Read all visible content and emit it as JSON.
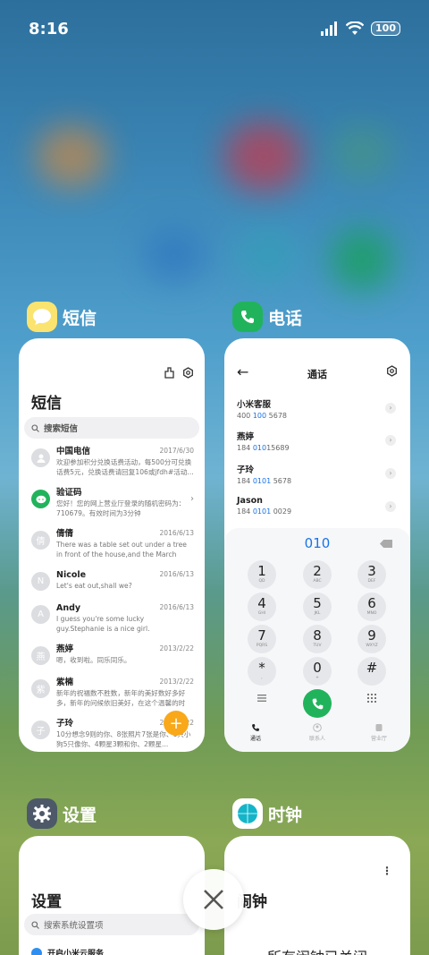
{
  "status": {
    "time": "8:16",
    "battery": "100"
  },
  "apps": {
    "messages": {
      "label": "短信",
      "title": "短信",
      "search_placeholder": "搜索短信",
      "items": [
        {
          "avatar": "",
          "name": "中国电信",
          "date": "2017/6/30",
          "body": "欢迎参加积分兑换话费活动，每500分可兑换话费5元，兑换话费请回复106或jfdh#活动..."
        },
        {
          "avatar": "",
          "name": "验证码",
          "date": "",
          "body": "您好！您的网上营业厅登录的随机密码为：710679。有效时间为3分钟"
        },
        {
          "avatar": "倩",
          "name": "倩倩",
          "date": "2016/6/13",
          "body": "There was a table set out under a tree in front of the house,and the March Hare an..."
        },
        {
          "avatar": "N",
          "name": "Nicole",
          "date": "2016/6/13",
          "body": "Let's eat out,shall we?"
        },
        {
          "avatar": "A",
          "name": "Andy",
          "date": "2016/6/13",
          "body": "I guess you're some lucky guy.Stephanie is a nice girl."
        },
        {
          "avatar": "燕",
          "name": "燕婷",
          "date": "2013/2/22",
          "body": "嗯，收到啦。同乐同乐。"
        },
        {
          "avatar": "紫",
          "name": "紫楠",
          "date": "2013/2/22",
          "body": "新年的祝福数不胜数，新年的美好数好多好多，新年的问候依旧美好，在这个温馨的时刻..."
        },
        {
          "avatar": "子",
          "name": "子玲",
          "date": "2013/2/22",
          "body": "10分想念9则的你、8张照片7张是你、6只小狗5只像你、4颗星3颗和你、2颗星..."
        }
      ]
    },
    "phone": {
      "label": "电话",
      "title": "通话",
      "contacts": [
        {
          "name": "小米客服",
          "pre": "400 ",
          "hl": "100",
          "post": " 5678"
        },
        {
          "name": "燕婷",
          "pre": "184 ",
          "hl": "010",
          "post": "15689"
        },
        {
          "name": "子玲",
          "pre": "184 ",
          "hl": "0101",
          "post": " 5678"
        },
        {
          "name": "Jason",
          "pre": "184 ",
          "hl": "0101",
          "post": " 0029"
        }
      ],
      "dialed": "010",
      "keys": [
        {
          "d": "1",
          "l": "QD"
        },
        {
          "d": "2",
          "l": "ABC"
        },
        {
          "d": "3",
          "l": "DEF"
        },
        {
          "d": "4",
          "l": "GHI"
        },
        {
          "d": "5",
          "l": "JKL"
        },
        {
          "d": "6",
          "l": "MNO"
        },
        {
          "d": "7",
          "l": "PQRS"
        },
        {
          "d": "8",
          "l": "TUV"
        },
        {
          "d": "9",
          "l": "WXYZ"
        },
        {
          "d": "*",
          "l": ","
        },
        {
          "d": "0",
          "l": "+"
        },
        {
          "d": "#",
          "l": ""
        }
      ],
      "tabs": [
        "通话",
        "联系人",
        "营业厅"
      ]
    },
    "settings": {
      "label": "设置",
      "title": "设置",
      "search_placeholder": "搜索系统设置项",
      "first_item": "开启小米云服务"
    },
    "clock": {
      "label": "时钟",
      "title": "闹钟",
      "empty_text": "所有闹钟已关闭"
    }
  },
  "colors": {
    "accent": "#1a73e8",
    "call": "#21b35c",
    "fab": "#f9a81a"
  }
}
